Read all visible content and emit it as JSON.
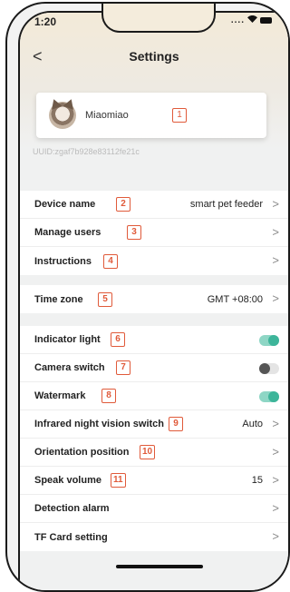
{
  "status_bar": {
    "time": "1:20",
    "signal": "....",
    "wifi_icon": "wifi-icon",
    "battery_icon": "battery-icon"
  },
  "nav": {
    "back": "<",
    "title": "Settings"
  },
  "profile": {
    "name": "Miaomiao",
    "badge": "1"
  },
  "uuid": "UUID:zgaf7b928e83112fe21c",
  "group1": [
    {
      "label": "Device name",
      "badge": "2",
      "value": "smart pet feeder",
      "chevron": ">"
    },
    {
      "label": "Manage users",
      "badge": "3",
      "chevron": ">"
    },
    {
      "label": "Instructions",
      "badge": "4",
      "chevron": ">"
    }
  ],
  "group2": [
    {
      "label": "Time zone",
      "badge": "5",
      "value": "GMT +08:00",
      "chevron": ">"
    }
  ],
  "group3": [
    {
      "label": "Indicator light",
      "badge": "6",
      "toggle": "on"
    },
    {
      "label": "Camera switch",
      "badge": "7",
      "toggle": "off"
    },
    {
      "label": "Watermark",
      "badge": "8",
      "toggle": "on"
    },
    {
      "label": "Infrared night vision switch",
      "badge": "9",
      "value": "Auto",
      "chevron": ">"
    },
    {
      "label": "Orientation position",
      "badge": "10",
      "chevron": ">"
    },
    {
      "label": "Speak volume",
      "badge": "11",
      "value": "15",
      "chevron": ">"
    },
    {
      "label": "Detection alarm",
      "chevron": ">"
    },
    {
      "label": "TF Card setting",
      "chevron": ">"
    }
  ],
  "colors": {
    "accent": "#3db59a",
    "badge": "#e05a3a"
  }
}
